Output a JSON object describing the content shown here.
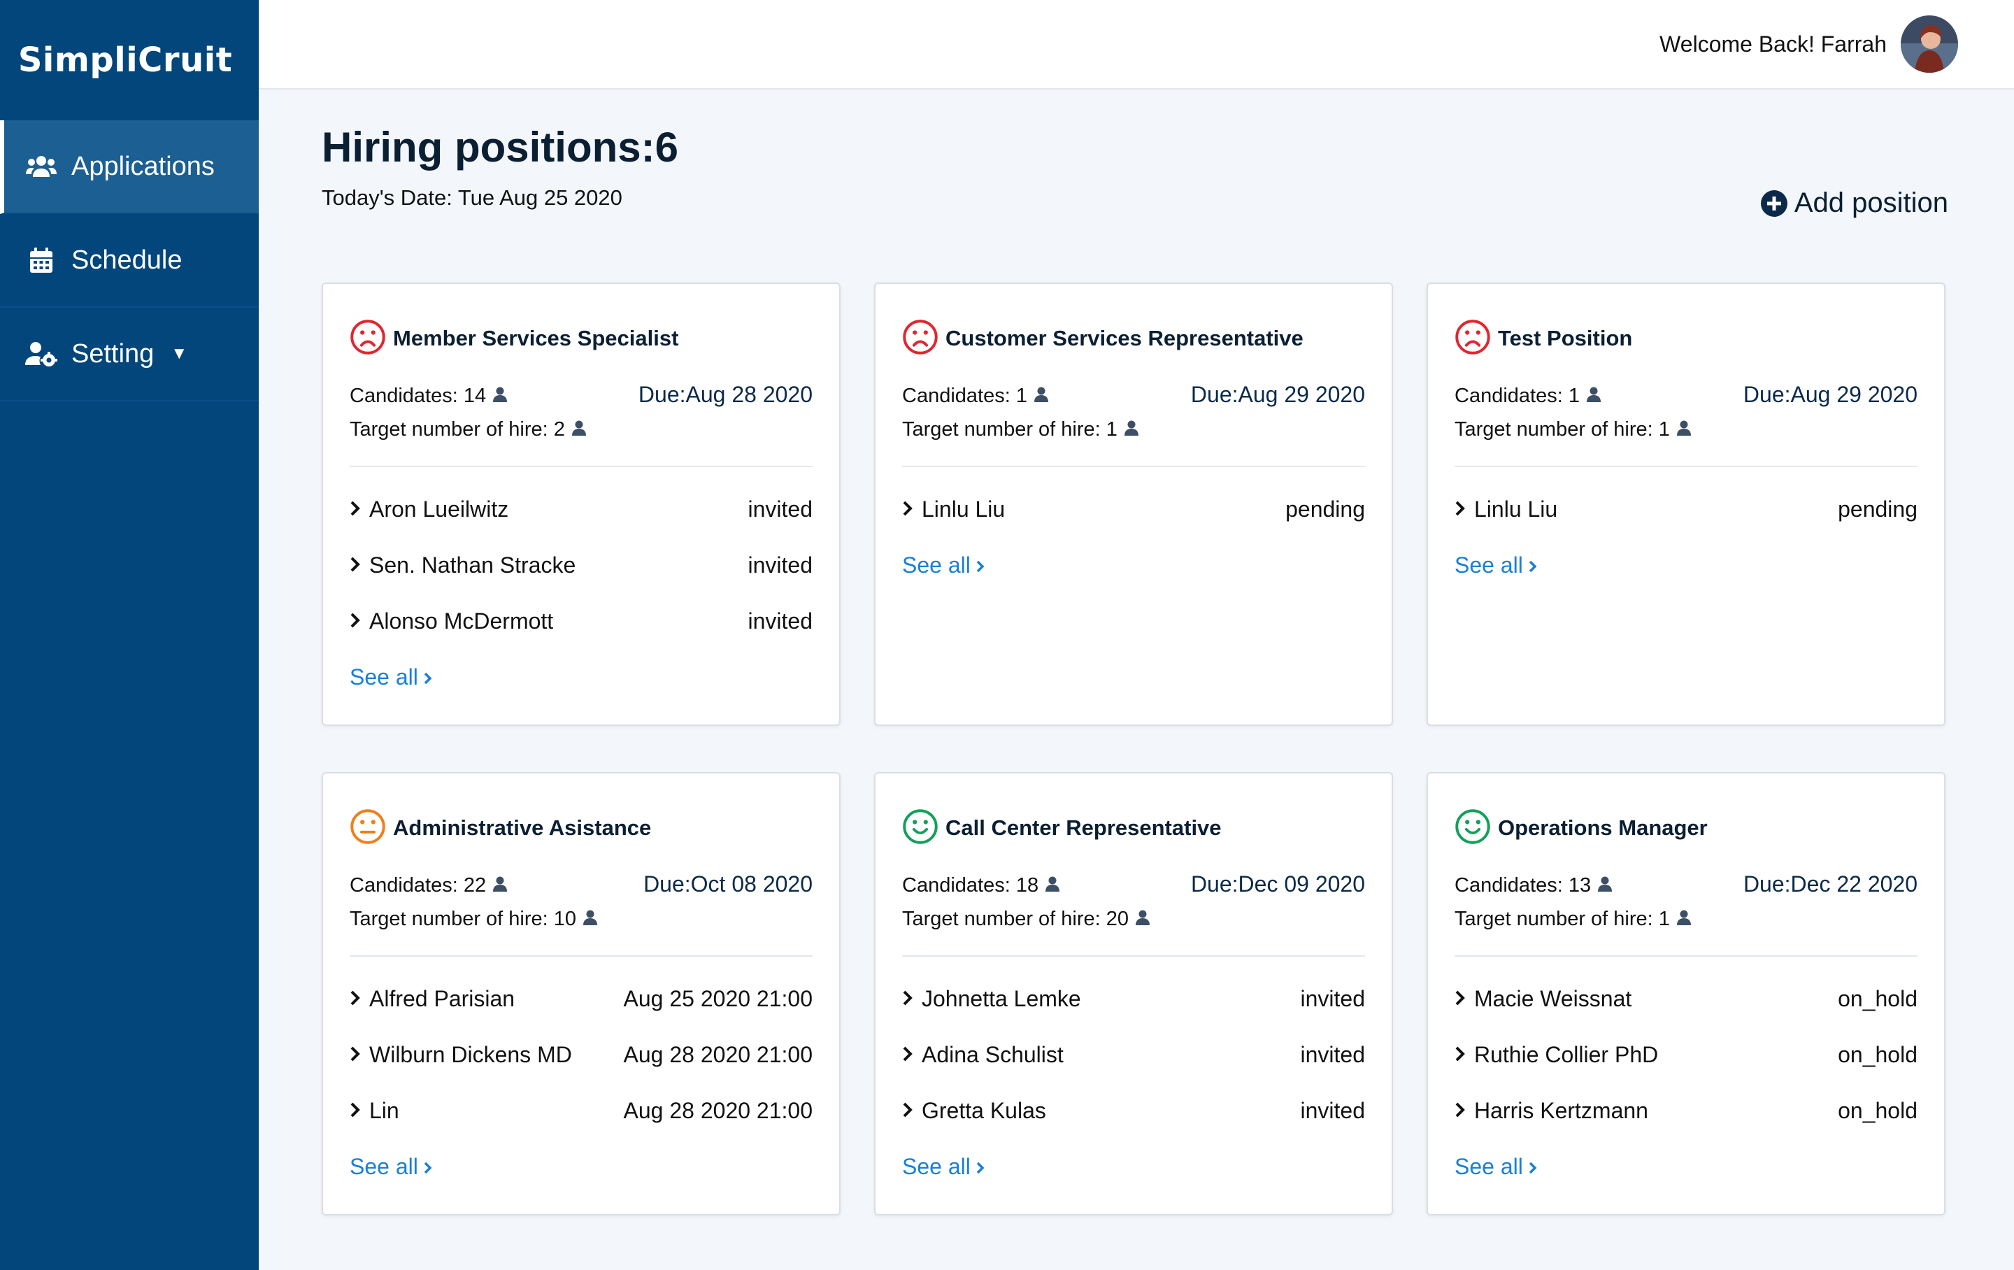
{
  "brand": {
    "name": "SimpliCruit"
  },
  "sidebar": {
    "items": [
      {
        "label": "Applications",
        "icon": "users-icon"
      },
      {
        "label": "Schedule",
        "icon": "calendar-icon"
      },
      {
        "label": "Setting",
        "icon": "user-gear-icon"
      }
    ]
  },
  "header": {
    "welcome": "Welcome Back! Farrah"
  },
  "page": {
    "title_prefix": "Hiring positions:",
    "title_count": "6",
    "today": "Today's Date: Tue Aug 25 2020",
    "add_label": "Add position"
  },
  "labels": {
    "see_all": "See all"
  },
  "colors": {
    "sidebar": "#02467b",
    "red": "#e0262f",
    "orange": "#f07f1a",
    "green": "#13a05a",
    "link": "#1a7fd6"
  },
  "positions": [
    {
      "title": "Member Services Specialist",
      "status": "sad",
      "candidates": "Candidates: 14",
      "target": "Target number of hire: 2",
      "due": "Due:Aug 28 2020",
      "rows": [
        {
          "name": "Aron Lueilwitz",
          "value": "invited"
        },
        {
          "name": "Sen. Nathan Stracke",
          "value": "invited"
        },
        {
          "name": "Alonso McDermott",
          "value": "invited"
        }
      ]
    },
    {
      "title": "Customer Services Representative",
      "status": "sad",
      "candidates": "Candidates: 1",
      "target": "Target number of hire: 1",
      "due": "Due:Aug 29 2020",
      "rows": [
        {
          "name": "Linlu Liu",
          "value": "pending"
        }
      ]
    },
    {
      "title": "Test Position",
      "status": "sad",
      "candidates": "Candidates: 1",
      "target": "Target number of hire: 1",
      "due": "Due:Aug 29 2020",
      "rows": [
        {
          "name": "Linlu Liu",
          "value": "pending"
        }
      ]
    },
    {
      "title": "Administrative Asistance",
      "status": "neutral",
      "candidates": "Candidates: 22",
      "target": "Target number of hire: 10",
      "due": "Due:Oct 08 2020",
      "rows": [
        {
          "name": "Alfred Parisian",
          "value": "Aug 25 2020 21:00"
        },
        {
          "name": "Wilburn Dickens MD",
          "value": "Aug 28 2020 21:00"
        },
        {
          "name": "Lin",
          "value": "Aug 28 2020 21:00"
        }
      ]
    },
    {
      "title": "Call Center Representative",
      "status": "happy",
      "candidates": "Candidates: 18",
      "target": "Target number of hire: 20",
      "due": "Due:Dec 09 2020",
      "rows": [
        {
          "name": "Johnetta Lemke",
          "value": "invited"
        },
        {
          "name": "Adina Schulist",
          "value": "invited"
        },
        {
          "name": "Gretta Kulas",
          "value": "invited"
        }
      ]
    },
    {
      "title": "Operations Manager",
      "status": "happy",
      "candidates": "Candidates: 13",
      "target": "Target number of hire: 1",
      "due": "Due:Dec 22 2020",
      "rows": [
        {
          "name": "Macie Weissnat",
          "value": "on_hold"
        },
        {
          "name": "Ruthie Collier PhD",
          "value": "on_hold"
        },
        {
          "name": "Harris Kertzmann",
          "value": "on_hold"
        }
      ]
    }
  ]
}
